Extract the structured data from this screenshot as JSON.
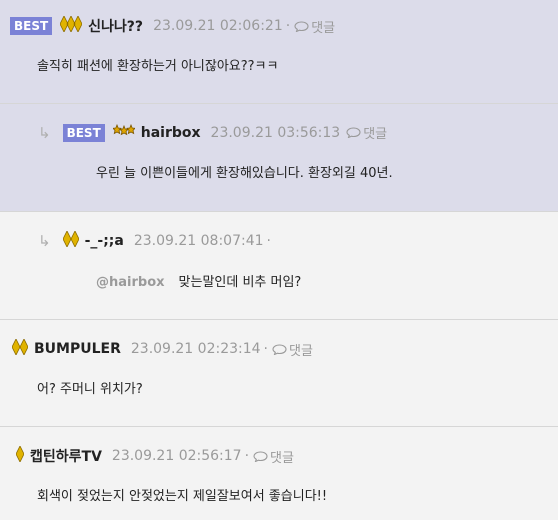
{
  "reply_label": "댓글",
  "comments": [
    {
      "badge": "BEST",
      "nick": "신나나??",
      "date": "23.09.21 02:06:21",
      "body": "솔직히 패션에 환장하는거 아니잖아요??ㅋㅋ"
    },
    {
      "badge": "BEST",
      "nick": "hairbox",
      "date": "23.09.21 03:56:13",
      "body": "우린 늘 이쁜이들에게 환장해있습니다. 환장외길 40년."
    },
    {
      "nick": "-_-;;a",
      "date": "23.09.21 08:07:41",
      "mention": "@hairbox",
      "body": "맞는말인데 비추 머임?"
    },
    {
      "nick": "BUMPULER",
      "date": "23.09.21 02:23:14",
      "body": "어? 주머니 위치가?"
    },
    {
      "nick": "캡틴하루TV",
      "date": "23.09.21 02:56:17",
      "body": "회색이 젖었는지 안젖었는지 제일잘보여서 좋습니다!!"
    }
  ],
  "colors": {
    "best_bg": "#dcdcea",
    "badge": "#7b82d6",
    "meta": "#9a9a9a"
  }
}
